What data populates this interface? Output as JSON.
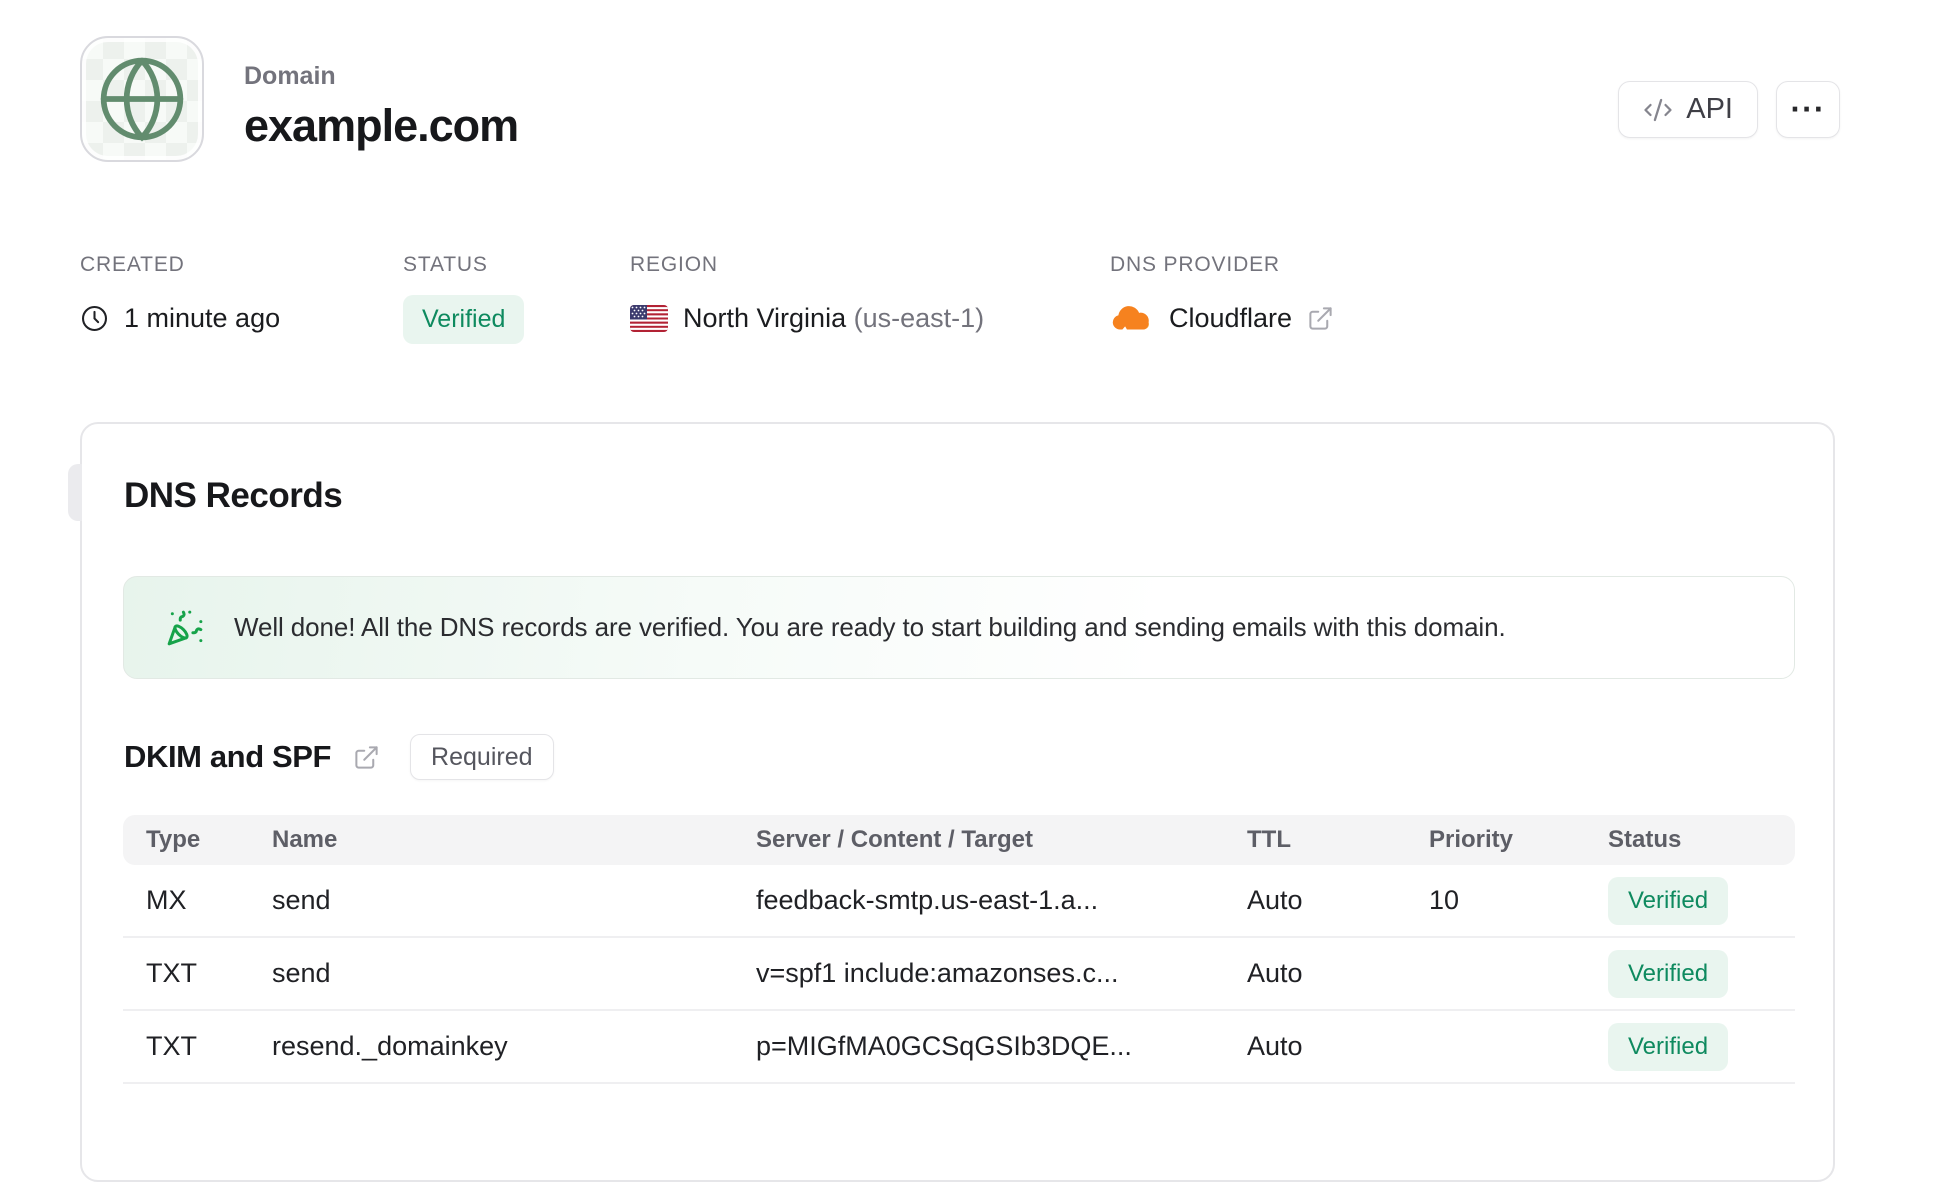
{
  "header": {
    "eyebrow": "Domain",
    "title": "example.com",
    "actions": {
      "api": "API",
      "more": "···"
    }
  },
  "meta": {
    "created": {
      "label": "CREATED",
      "value": "1 minute ago"
    },
    "status": {
      "label": "STATUS",
      "badge": "Verified"
    },
    "region": {
      "label": "REGION",
      "value": "North Virginia",
      "code": "(us-east-1)"
    },
    "provider": {
      "label": "DNS PROVIDER",
      "value": "Cloudflare"
    }
  },
  "dns": {
    "title": "DNS Records",
    "banner": "Well done! All the DNS records are verified. You are ready to start building and sending emails with this domain.",
    "dkim": {
      "title": "DKIM and SPF",
      "badge": "Required"
    },
    "table": {
      "columns": [
        "Type",
        "Name",
        "Server / Content / Target",
        "TTL",
        "Priority",
        "Status"
      ],
      "rows": [
        {
          "type": "MX",
          "name": "send",
          "content": "feedback-smtp.us-east-1.a...",
          "ttl": "Auto",
          "priority": "10",
          "status": "Verified"
        },
        {
          "type": "TXT",
          "name": "send",
          "content": "v=spf1 include:amazonses.c...",
          "ttl": "Auto",
          "priority": "",
          "status": "Verified"
        },
        {
          "type": "TXT",
          "name": "resend._domainkey",
          "content": "p=MIGfMA0GCSqGSIb3DQE...",
          "ttl": "Auto",
          "priority": "",
          "status": "Verified"
        }
      ]
    }
  },
  "icons": {
    "tile": "globe-icon",
    "created": "clock-icon",
    "region": "us-flag-icon",
    "provider": "cloudflare-icon",
    "provider_link": "external-link-icon",
    "dkim_link": "external-link-icon",
    "api": "code-icon",
    "more": "ellipsis-icon",
    "banner": "party-popper-icon"
  },
  "colors": {
    "verified_text": "#0e8a5f",
    "verified_bg": "#e9f5ef",
    "cloudflare_orange": "#f6821f",
    "success_green": "#16a34a",
    "globe_green": "#628c6e",
    "table_header_bg": "#f4f4f5"
  }
}
